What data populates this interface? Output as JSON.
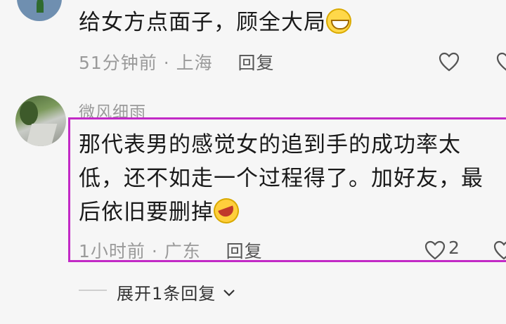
{
  "comments": [
    {
      "text": "给女方点面子，顾全大局",
      "emoji": "grinning-face-emoji",
      "time": "51分钟前",
      "separator": "·",
      "location": "上海",
      "reply_label": "回复"
    },
    {
      "username": "微风细雨",
      "text_line1": "那代表男的感觉女的追到手的成功率太",
      "text_line2": "低，还不如走一个过程得了。加好友，最",
      "text_line3": "后依旧要删掉",
      "emoji": "laughing-tears-emoji",
      "time": "1小时前",
      "separator": "·",
      "location": "广东",
      "reply_label": "回复",
      "like_count": "2"
    }
  ],
  "expand_replies_label": "展开1条回复",
  "colors": {
    "highlight_border": "#c22ac6",
    "meta_text": "#9a9a9a"
  },
  "icons": [
    "like-heart-icon",
    "chevron-down-icon"
  ]
}
